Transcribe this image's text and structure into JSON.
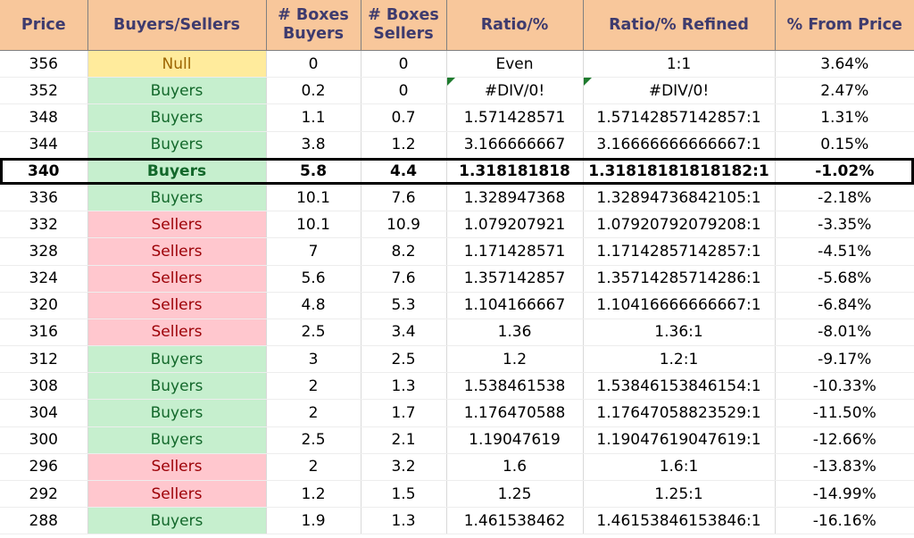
{
  "table": {
    "columns": [
      {
        "key": "price",
        "label_lines": [
          "Price"
        ]
      },
      {
        "key": "bs",
        "label_lines": [
          "Buyers/Sellers"
        ]
      },
      {
        "key": "bb",
        "label_lines": [
          "# Boxes",
          "Buyers"
        ]
      },
      {
        "key": "bsel",
        "label_lines": [
          "# Boxes",
          "Sellers"
        ]
      },
      {
        "key": "ratio",
        "label_lines": [
          "Ratio/%"
        ]
      },
      {
        "key": "refined",
        "label_lines": [
          "Ratio/% Refined"
        ]
      },
      {
        "key": "from",
        "label_lines": [
          "% From Price"
        ]
      }
    ],
    "rows": [
      {
        "price": "356",
        "state": "Null",
        "state_kind": "null",
        "boxes_buyers": "0",
        "boxes_sellers": "0",
        "ratio": "Even",
        "ratio_error": false,
        "refined": "1:1",
        "refined_error": false,
        "from_price": "3.64%",
        "highlight": false
      },
      {
        "price": "352",
        "state": "Buyers",
        "state_kind": "buyers",
        "boxes_buyers": "0.2",
        "boxes_sellers": "0",
        "ratio": "#DIV/0!",
        "ratio_error": true,
        "refined": "#DIV/0!",
        "refined_error": true,
        "from_price": "2.47%",
        "highlight": false
      },
      {
        "price": "348",
        "state": "Buyers",
        "state_kind": "buyers",
        "boxes_buyers": "1.1",
        "boxes_sellers": "0.7",
        "ratio": "1.571428571",
        "ratio_error": false,
        "refined": "1.57142857142857:1",
        "refined_error": false,
        "from_price": "1.31%",
        "highlight": false
      },
      {
        "price": "344",
        "state": "Buyers",
        "state_kind": "buyers",
        "boxes_buyers": "3.8",
        "boxes_sellers": "1.2",
        "ratio": "3.166666667",
        "ratio_error": false,
        "refined": "3.16666666666667:1",
        "refined_error": false,
        "from_price": "0.15%",
        "highlight": false
      },
      {
        "price": "340",
        "state": "Buyers",
        "state_kind": "buyers",
        "boxes_buyers": "5.8",
        "boxes_sellers": "4.4",
        "ratio": "1.318181818",
        "ratio_error": false,
        "refined": "1.31818181818182:1",
        "refined_error": false,
        "from_price": "-1.02%",
        "highlight": true
      },
      {
        "price": "336",
        "state": "Buyers",
        "state_kind": "buyers",
        "boxes_buyers": "10.1",
        "boxes_sellers": "7.6",
        "ratio": "1.328947368",
        "ratio_error": false,
        "refined": "1.32894736842105:1",
        "refined_error": false,
        "from_price": "-2.18%",
        "highlight": false
      },
      {
        "price": "332",
        "state": "Sellers",
        "state_kind": "sellers",
        "boxes_buyers": "10.1",
        "boxes_sellers": "10.9",
        "ratio": "1.079207921",
        "ratio_error": false,
        "refined": "1.07920792079208:1",
        "refined_error": false,
        "from_price": "-3.35%",
        "highlight": false
      },
      {
        "price": "328",
        "state": "Sellers",
        "state_kind": "sellers",
        "boxes_buyers": "7",
        "boxes_sellers": "8.2",
        "ratio": "1.171428571",
        "ratio_error": false,
        "refined": "1.17142857142857:1",
        "refined_error": false,
        "from_price": "-4.51%",
        "highlight": false
      },
      {
        "price": "324",
        "state": "Sellers",
        "state_kind": "sellers",
        "boxes_buyers": "5.6",
        "boxes_sellers": "7.6",
        "ratio": "1.357142857",
        "ratio_error": false,
        "refined": "1.35714285714286:1",
        "refined_error": false,
        "from_price": "-5.68%",
        "highlight": false
      },
      {
        "price": "320",
        "state": "Sellers",
        "state_kind": "sellers",
        "boxes_buyers": "4.8",
        "boxes_sellers": "5.3",
        "ratio": "1.104166667",
        "ratio_error": false,
        "refined": "1.10416666666667:1",
        "refined_error": false,
        "from_price": "-6.84%",
        "highlight": false
      },
      {
        "price": "316",
        "state": "Sellers",
        "state_kind": "sellers",
        "boxes_buyers": "2.5",
        "boxes_sellers": "3.4",
        "ratio": "1.36",
        "ratio_error": false,
        "refined": "1.36:1",
        "refined_error": false,
        "from_price": "-8.01%",
        "highlight": false
      },
      {
        "price": "312",
        "state": "Buyers",
        "state_kind": "buyers",
        "boxes_buyers": "3",
        "boxes_sellers": "2.5",
        "ratio": "1.2",
        "ratio_error": false,
        "refined": "1.2:1",
        "refined_error": false,
        "from_price": "-9.17%",
        "highlight": false
      },
      {
        "price": "308",
        "state": "Buyers",
        "state_kind": "buyers",
        "boxes_buyers": "2",
        "boxes_sellers": "1.3",
        "ratio": "1.538461538",
        "ratio_error": false,
        "refined": "1.53846153846154:1",
        "refined_error": false,
        "from_price": "-10.33%",
        "highlight": false
      },
      {
        "price": "304",
        "state": "Buyers",
        "state_kind": "buyers",
        "boxes_buyers": "2",
        "boxes_sellers": "1.7",
        "ratio": "1.176470588",
        "ratio_error": false,
        "refined": "1.17647058823529:1",
        "refined_error": false,
        "from_price": "-11.50%",
        "highlight": false
      },
      {
        "price": "300",
        "state": "Buyers",
        "state_kind": "buyers",
        "boxes_buyers": "2.5",
        "boxes_sellers": "2.1",
        "ratio": "1.19047619",
        "ratio_error": false,
        "refined": "1.19047619047619:1",
        "refined_error": false,
        "from_price": "-12.66%",
        "highlight": false
      },
      {
        "price": "296",
        "state": "Sellers",
        "state_kind": "sellers",
        "boxes_buyers": "2",
        "boxes_sellers": "3.2",
        "ratio": "1.6",
        "ratio_error": false,
        "refined": "1.6:1",
        "refined_error": false,
        "from_price": "-13.83%",
        "highlight": false
      },
      {
        "price": "292",
        "state": "Sellers",
        "state_kind": "sellers",
        "boxes_buyers": "1.2",
        "boxes_sellers": "1.5",
        "ratio": "1.25",
        "ratio_error": false,
        "refined": "1.25:1",
        "refined_error": false,
        "from_price": "-14.99%",
        "highlight": false
      },
      {
        "price": "288",
        "state": "Buyers",
        "state_kind": "buyers",
        "boxes_buyers": "1.9",
        "boxes_sellers": "1.3",
        "ratio": "1.461538462",
        "ratio_error": false,
        "refined": "1.46153846153846:1",
        "refined_error": false,
        "from_price": "-16.16%",
        "highlight": false
      }
    ]
  },
  "colors": {
    "header_fill": "#F8C79B",
    "header_text": "#3E3B6E",
    "buyers_fill": "#C6EFCE",
    "buyers_text": "#13682B",
    "sellers_fill": "#FFC7CE",
    "sellers_text": "#9C0006",
    "null_fill": "#FFEB9C",
    "null_text": "#9C6500",
    "error_flag": "#1E7B2E",
    "highlight_border": "#000000",
    "gridline": "#D9D9D9"
  }
}
